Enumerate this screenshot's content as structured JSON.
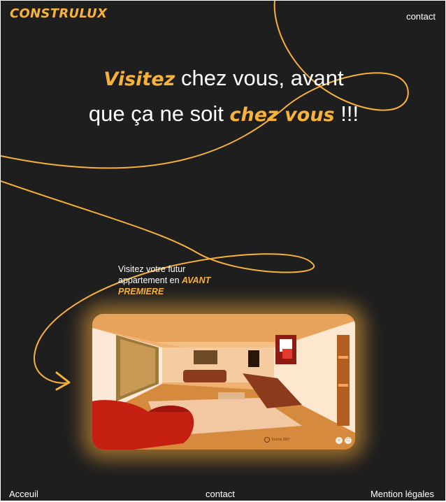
{
  "brand": {
    "logo": "CONSTRULUX",
    "accent_color": "#f7b23b"
  },
  "nav": {
    "contact": "contact"
  },
  "hero": {
    "part1": "Visitez",
    "part2": " chez vous, avant",
    "part3": "que ça ne soit ",
    "part4": "chez vous",
    "part5": " !!!"
  },
  "promo": {
    "line1": "Visitez votre futur",
    "line2": "appartement en ",
    "highlight1": "AVANT",
    "highlight2": "PREMIERE"
  },
  "viewer": {
    "badge_label": "Tourné 360°",
    "icons": [
      "vr-icon",
      "fullscreen-icon"
    ]
  },
  "footer": {
    "home": "Acceuil",
    "contact": "contact",
    "legal": "Mention légales"
  }
}
